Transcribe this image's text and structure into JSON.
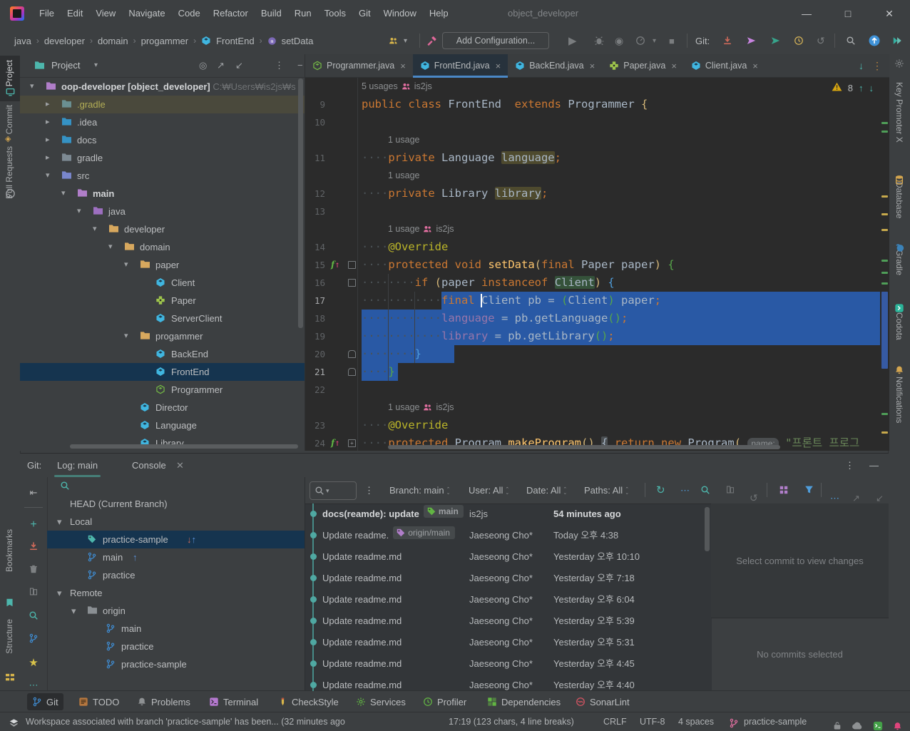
{
  "titlebar": {
    "title": "object_developer",
    "menus": [
      "File",
      "Edit",
      "View",
      "Navigate",
      "Code",
      "Refactor",
      "Build",
      "Run",
      "Tools",
      "Git",
      "Window",
      "Help"
    ]
  },
  "toolbar": {
    "breadcrumbs": [
      {
        "label": "java"
      },
      {
        "label": "developer"
      },
      {
        "label": "domain"
      },
      {
        "label": "progammer"
      },
      {
        "label": "FrontEnd",
        "icon": "class"
      },
      {
        "label": "setData",
        "icon": "method"
      }
    ],
    "add_configuration": "Add Configuration...",
    "git_label": "Git:",
    "run_icons": [
      "run",
      "debug",
      "run-with-coverage",
      "profiler",
      "run-options-dropdown",
      "stop"
    ],
    "git_icons": [
      "update-project",
      "push",
      "incoming-changes",
      "history",
      "rollback"
    ],
    "far_icons": [
      "search-everywhere",
      "ide-update",
      "code-with-me"
    ]
  },
  "tabs": [
    {
      "label": "Programmer.java",
      "icon": "class-abstract",
      "active": false
    },
    {
      "label": "FrontEnd.java",
      "icon": "class",
      "active": true
    },
    {
      "label": "BackEnd.java",
      "icon": "class",
      "active": false
    },
    {
      "label": "Paper.java",
      "icon": "class-plus",
      "active": false
    },
    {
      "label": "Client.java",
      "icon": "class",
      "active": false
    }
  ],
  "left_strip": {
    "top": [
      {
        "label": "Project",
        "icon": "monitor",
        "active": true
      },
      {
        "label": "Commit",
        "icon": "commit-diamond",
        "active": false
      },
      {
        "label": "Pull Requests",
        "icon": "octocat",
        "active": false
      }
    ],
    "bottom": [
      {
        "label": "Bookmarks",
        "icon": "bookmarks"
      },
      {
        "label": "Structure",
        "icon": "structure"
      }
    ]
  },
  "right_strip": [
    {
      "label": "Key Promoter X",
      "icon": "gear"
    },
    {
      "label": "Database",
      "icon": "database"
    },
    {
      "label": "Gradle",
      "icon": "gradle"
    },
    {
      "label": "Codota",
      "icon": "codota"
    },
    {
      "label": "Notifications",
      "icon": "bell"
    }
  ],
  "project_panel": {
    "title": "Project",
    "tree": [
      {
        "label": "oop-developer [object_developer]",
        "path": "  C:₩Users₩is2js₩s",
        "icon": "folder-project",
        "lvl": 0,
        "chevron": "down",
        "bold": true
      },
      {
        "label": ".gradle",
        "icon": "folder-excluded",
        "lvl": 1,
        "chevron": "right",
        "hover": true,
        "olive": true
      },
      {
        "label": ".idea",
        "icon": "folder-idea",
        "lvl": 1,
        "chevron": "right"
      },
      {
        "label": "docs",
        "icon": "folder-docs",
        "lvl": 1,
        "chevron": "right"
      },
      {
        "label": "gradle",
        "icon": "folder-gradle",
        "lvl": 1,
        "chevron": "right"
      },
      {
        "label": "src",
        "icon": "folder-src",
        "lvl": 1,
        "chevron": "down"
      },
      {
        "label": "main",
        "icon": "folder-main",
        "lvl": 2,
        "chevron": "down",
        "bold": true
      },
      {
        "label": "java",
        "icon": "folder-java",
        "lvl": 3,
        "chevron": "down"
      },
      {
        "label": "developer",
        "icon": "folder-pkg",
        "lvl": 4,
        "chevron": "down"
      },
      {
        "label": "domain",
        "icon": "folder-pkg",
        "lvl": 5,
        "chevron": "down"
      },
      {
        "label": "paper",
        "icon": "folder-pkg",
        "lvl": 6,
        "chevron": "down"
      },
      {
        "label": "Client",
        "icon": "class",
        "lvl": 7
      },
      {
        "label": "Paper",
        "icon": "class-plus",
        "lvl": 7
      },
      {
        "label": "ServerClient",
        "icon": "class",
        "lvl": 7
      },
      {
        "label": "progammer",
        "icon": "folder-pkg",
        "lvl": 6,
        "chevron": "down"
      },
      {
        "label": "BackEnd",
        "icon": "class",
        "lvl": 7
      },
      {
        "label": "FrontEnd",
        "icon": "class",
        "lvl": 7,
        "selected": true
      },
      {
        "label": "Programmer",
        "icon": "class-abstract",
        "lvl": 7
      },
      {
        "label": "Director",
        "icon": "class",
        "lvl": 6
      },
      {
        "label": "Language",
        "icon": "class",
        "lvl": 6
      },
      {
        "label": "Library",
        "icon": "class",
        "lvl": 6
      }
    ]
  },
  "editor": {
    "warnings": "8",
    "rows": [
      {
        "inlay": true,
        "pad": 0,
        "parts": [
          {
            "t": "5 usages"
          },
          {
            "icon": "users"
          },
          {
            "t": "is2js"
          }
        ]
      },
      {
        "n": "9",
        "tk": [
          [
            "k",
            "public"
          ],
          [
            "t",
            " "
          ],
          [
            "k",
            "class"
          ],
          [
            "t",
            " FrontEnd  "
          ],
          [
            "k",
            "extends"
          ],
          [
            "t",
            " Programmer "
          ],
          [
            "y",
            "{"
          ]
        ]
      },
      {
        "n": "10",
        "tk": []
      },
      {
        "inlay": true,
        "pad": 37,
        "parts": [
          {
            "t": "1 usage"
          }
        ]
      },
      {
        "n": "11",
        "tk": [
          [
            "w",
            "····"
          ],
          [
            "k",
            "private"
          ],
          [
            "t",
            " Language "
          ],
          [
            "hf",
            "language"
          ],
          [
            "k",
            ";"
          ]
        ]
      },
      {
        "inlay": true,
        "pad": 37,
        "parts": [
          {
            "t": "1 usage"
          }
        ]
      },
      {
        "n": "12",
        "tk": [
          [
            "w",
            "····"
          ],
          [
            "k",
            "private"
          ],
          [
            "t",
            " Library "
          ],
          [
            "hf",
            "library"
          ],
          [
            "k",
            ";"
          ]
        ]
      },
      {
        "n": "13",
        "tk": []
      },
      {
        "inlay": true,
        "pad": 37,
        "parts": [
          {
            "t": "1 usage"
          },
          {
            "icon": "users"
          },
          {
            "t": "is2js"
          }
        ]
      },
      {
        "n": "14",
        "tk": [
          [
            "w",
            "····"
          ],
          [
            "a",
            "@Override"
          ]
        ]
      },
      {
        "n": "15",
        "g": [
          "ov",
          "ft"
        ],
        "tk": [
          [
            "w",
            "····"
          ],
          [
            "k",
            "protected"
          ],
          [
            "t",
            " "
          ],
          [
            "k",
            "void"
          ],
          [
            "t",
            " "
          ],
          [
            "m",
            "setData"
          ],
          [
            "y",
            "("
          ],
          [
            "k",
            "final"
          ],
          [
            "t",
            " Paper paper"
          ],
          [
            "y",
            ")"
          ],
          [
            "t",
            " "
          ],
          [
            "g2",
            "{"
          ]
        ]
      },
      {
        "n": "16",
        "g": [
          "ft"
        ],
        "tk": [
          [
            "w",
            "········"
          ],
          [
            "k",
            "if"
          ],
          [
            "t",
            " "
          ],
          [
            "y",
            "("
          ],
          [
            "t",
            "paper "
          ],
          [
            "k",
            "instanceof"
          ],
          [
            "t",
            " "
          ],
          [
            "hc",
            "Client"
          ],
          [
            "y",
            ")"
          ],
          [
            "t",
            " "
          ],
          [
            "b2",
            "{"
          ]
        ]
      },
      {
        "n": "17",
        "brt": true,
        "sel": [
          12,
          null
        ],
        "caret": 18,
        "tk": [
          [
            "w",
            "············"
          ],
          [
            "k",
            "final"
          ],
          [
            "t",
            " Client pb = "
          ],
          [
            "g2",
            "("
          ],
          [
            "t",
            "Client"
          ],
          [
            "g2",
            ")"
          ],
          [
            "t",
            " paper"
          ],
          [
            "k",
            ";"
          ]
        ]
      },
      {
        "n": "18",
        "sel": [
          0,
          null
        ],
        "tk": [
          [
            "w",
            "············"
          ],
          [
            "f",
            "language"
          ],
          [
            "t",
            " = pb.getLanguage"
          ],
          [
            "g2",
            "()"
          ],
          [
            "k",
            ";"
          ]
        ]
      },
      {
        "n": "19",
        "sel": [
          0,
          null
        ],
        "tk": [
          [
            "w",
            "············"
          ],
          [
            "f",
            "library"
          ],
          [
            "t",
            " = pb.getLibrary"
          ],
          [
            "g2",
            "()"
          ],
          [
            "k",
            ";"
          ]
        ]
      },
      {
        "n": "20",
        "g": [
          "fb"
        ],
        "sel": [
          0,
          14
        ],
        "tk": [
          [
            "w",
            "········"
          ],
          [
            "b2",
            "}"
          ]
        ]
      },
      {
        "n": "21",
        "brt": true,
        "g": [
          "fb"
        ],
        "sel": [
          0,
          5.5
        ],
        "tk": [
          [
            "w",
            "····"
          ],
          [
            "g2",
            "}"
          ]
        ]
      },
      {
        "n": "22",
        "tk": []
      },
      {
        "inlay": true,
        "pad": 37,
        "parts": [
          {
            "t": "1 usage"
          },
          {
            "icon": "users"
          },
          {
            "t": "is2js"
          }
        ]
      },
      {
        "n": "23",
        "tk": [
          [
            "w",
            "····"
          ],
          [
            "a",
            "@Override"
          ]
        ]
      },
      {
        "n": "24",
        "g": [
          "ov",
          "fp"
        ],
        "tk": [
          [
            "w",
            "····"
          ],
          [
            "k",
            "protected"
          ],
          [
            "t",
            " Program "
          ],
          [
            "m",
            "makeProgram"
          ],
          [
            "y",
            "()"
          ],
          [
            "t",
            " "
          ],
          [
            "fd",
            "{"
          ],
          [
            "t",
            " "
          ],
          [
            "k",
            "return"
          ],
          [
            "t",
            " "
          ],
          [
            "k",
            "new"
          ],
          [
            "t",
            " Program"
          ],
          [
            "y",
            "("
          ],
          [
            "t",
            " "
          ],
          [
            "ph",
            "name:"
          ],
          [
            "t",
            " "
          ],
          [
            "s",
            "\"프론트 프로그"
          ]
        ]
      }
    ]
  },
  "git_panel": {
    "label": "Git:",
    "tabs": [
      {
        "label": "Log: main",
        "active": true
      },
      {
        "label": "Console",
        "close": true
      }
    ],
    "side_icons": [
      "collapse-left",
      "add",
      "download",
      "delete",
      "compare",
      "find",
      "new-branch",
      "star",
      "more"
    ],
    "branches": [
      {
        "label": "HEAD (Current Branch)",
        "ind": 0
      },
      {
        "label": "Local",
        "ind": 0,
        "chevron": "down"
      },
      {
        "label": "practice-sample",
        "ind": 1,
        "icon": "tag",
        "selected": true,
        "badge": "inout"
      },
      {
        "label": "main",
        "ind": 1,
        "icon": "branch",
        "badge": "up"
      },
      {
        "label": "practice",
        "ind": 1,
        "icon": "branch"
      },
      {
        "label": "Remote",
        "ind": 0,
        "chevron": "down"
      },
      {
        "label": "origin",
        "ind": 1,
        "icon": "folder-gray",
        "chevron": "down"
      },
      {
        "label": "main",
        "ind": 2,
        "icon": "branch"
      },
      {
        "label": "practice",
        "ind": 2,
        "icon": "branch"
      },
      {
        "label": "practice-sample",
        "ind": 2,
        "icon": "branch"
      }
    ],
    "filters": [
      "Branch: main",
      "User: All",
      "Date: All",
      "Paths: All"
    ],
    "filter_icons": [
      "refresh",
      "more",
      "find"
    ],
    "details_icons": [
      "preview",
      "rollback",
      "changes-grid",
      "filter",
      "more",
      "expand",
      "collapse"
    ],
    "commits": [
      {
        "subject": "docs(reamde): update",
        "chip": {
          "label": "main",
          "color": "green"
        },
        "author": "is2js",
        "date": "54 minutes ago",
        "bold": true
      },
      {
        "subject": "Update readme.",
        "chip": {
          "label": "origin/main",
          "color": "purple"
        },
        "author": "Jaeseong Cho*",
        "date": "Today 오후 4:38"
      },
      {
        "subject": "Update readme.md",
        "author": "Jaeseong Cho*",
        "date": "Yesterday 오후 10:10"
      },
      {
        "subject": "Update readme.md",
        "author": "Jaeseong Cho*",
        "date": "Yesterday 오후 7:18"
      },
      {
        "subject": "Update readme.md",
        "author": "Jaeseong Cho*",
        "date": "Yesterday 오후 6:04"
      },
      {
        "subject": "Update readme.md",
        "author": "Jaeseong Cho*",
        "date": "Yesterday 오후 5:39"
      },
      {
        "subject": "Update readme.md",
        "author": "Jaeseong Cho*",
        "date": "Yesterday 오후 5:31"
      },
      {
        "subject": "Update readme.md",
        "author": "Jaeseong Cho*",
        "date": "Yesterday 오후 4:45"
      },
      {
        "subject": "Update readme.md",
        "author": "Jaeseong Cho*",
        "date": "Yesterday 오후 4:40"
      }
    ],
    "details": {
      "top": "Select commit to view changes",
      "bottom": "No commits selected"
    }
  },
  "windowbar": [
    {
      "label": "Git",
      "icon": "branch",
      "active": true
    },
    {
      "label": "TODO",
      "icon": "todo"
    },
    {
      "label": "Problems",
      "icon": "problems"
    },
    {
      "label": "Terminal",
      "icon": "terminal"
    },
    {
      "label": "CheckStyle",
      "icon": "checkstyle"
    },
    {
      "label": "Services",
      "icon": "services"
    },
    {
      "label": "Profiler",
      "icon": "profiler"
    },
    {
      "label": "Dependencies",
      "icon": "dependencies"
    },
    {
      "label": "SonarLint",
      "icon": "sonarlint"
    }
  ],
  "statusbar": {
    "message": "Workspace associated with branch 'practice-sample' has been... (32 minutes ago",
    "caret": "17:19 (123 chars, 4 line breaks)",
    "line_ending": "CRLF",
    "encoding": "UTF-8",
    "indent": "4 spaces",
    "branch": "practice-sample",
    "icons": [
      "lock-unlocked",
      "cloud-settings",
      "terminal-badge",
      "alarm"
    ]
  }
}
